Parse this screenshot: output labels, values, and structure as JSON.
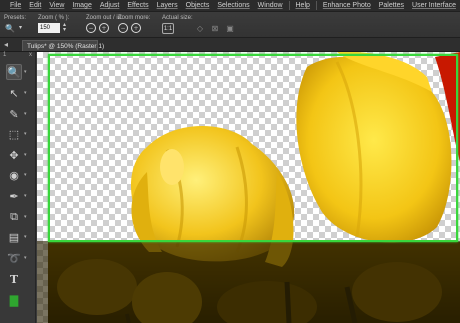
{
  "menu": {
    "items": [
      "File",
      "Edit",
      "View",
      "Image",
      "Adjust",
      "Effects",
      "Layers",
      "Objects",
      "Selections",
      "Window",
      "Help",
      "Enhance Photo",
      "Palettes",
      "User Interface"
    ]
  },
  "tool_options": {
    "presets_label": "Presets:",
    "zoom_label": "Zoom ( % ):",
    "zoom_value": "150",
    "zoom_inout_label": "Zoom out / in:",
    "zoom_more_label": "Zoom more:",
    "actual_size_label": "Actual size:"
  },
  "document_tab": {
    "title": "Tulips* @ 150% (Raster 1)"
  },
  "toolbox": {
    "header_left": "1",
    "header_right": "x",
    "tools": [
      {
        "name": "zoom-tool",
        "glyph": "🔍"
      },
      {
        "name": "pick-tool",
        "glyph": "↖"
      },
      {
        "name": "dropper-tool",
        "glyph": "✎"
      },
      {
        "name": "crop-tool",
        "glyph": "⬚"
      },
      {
        "name": "move-tool",
        "glyph": "✥"
      },
      {
        "name": "red-eye-tool",
        "glyph": "◉"
      },
      {
        "name": "brush-tool",
        "glyph": "✒"
      },
      {
        "name": "clone-tool",
        "glyph": "⧉"
      },
      {
        "name": "retouch-tool",
        "glyph": "▤"
      },
      {
        "name": "lasso-tool",
        "glyph": "➰"
      },
      {
        "name": "text-tool",
        "glyph": "T"
      },
      {
        "name": "fill-tool",
        "glyph": "▇"
      }
    ]
  },
  "colors": {
    "selection_border": "#39d63c",
    "petal": "#f0c419",
    "background": "#3a3a3a"
  }
}
